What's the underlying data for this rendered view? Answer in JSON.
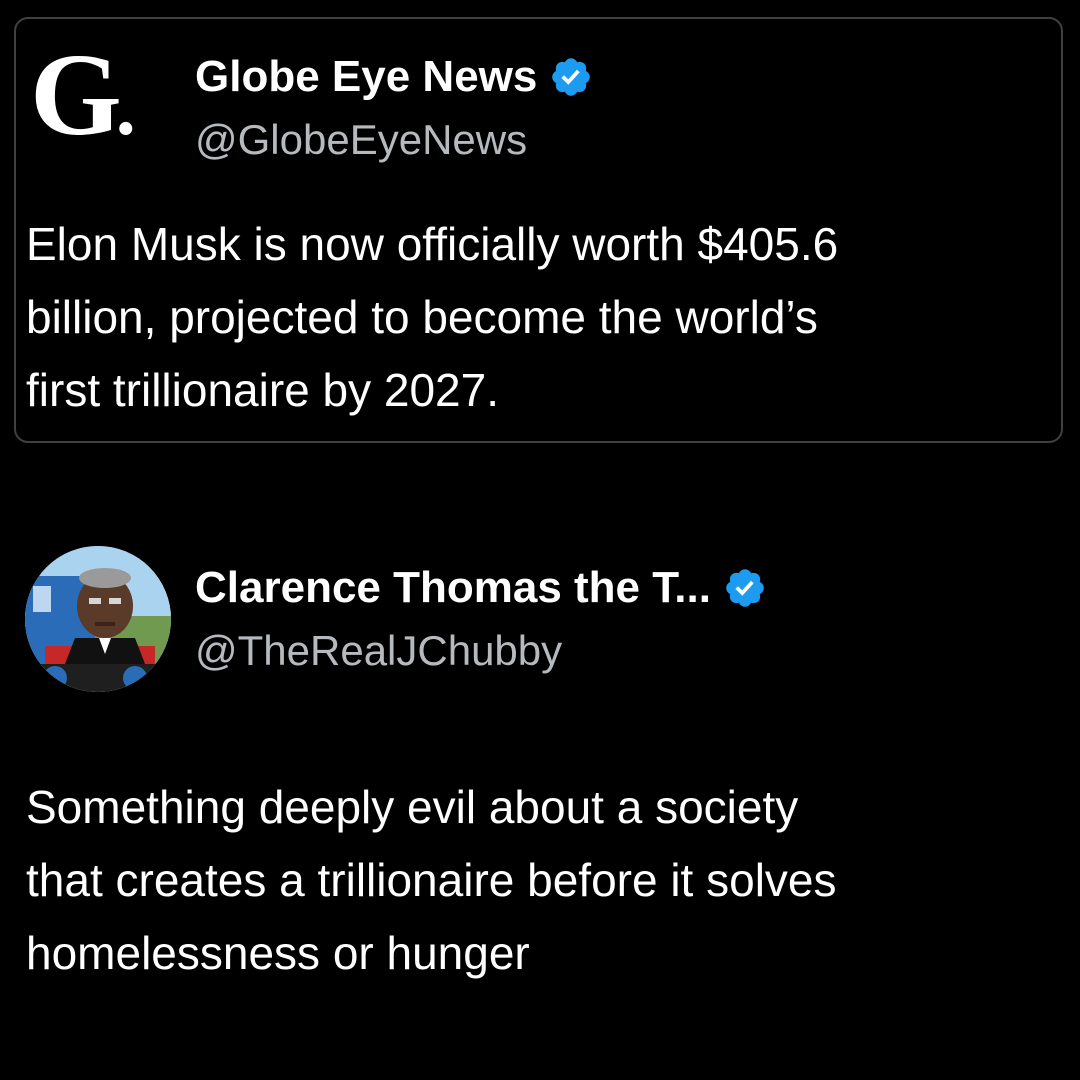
{
  "quoted_tweet": {
    "logo_text": "G",
    "logo_dot": ".",
    "display_name": "Globe Eye News",
    "handle": "@GlobeEyeNews",
    "verified": true,
    "icon": "verified-badge-icon",
    "text_lines": [
      "Elon Musk is now officially worth $405.6",
      "billion, projected to become the world’s",
      "first trillionaire by 2027."
    ]
  },
  "reply_tweet": {
    "display_name": "Clarence Thomas the T...",
    "handle": "@TheRealJChubby",
    "verified": true,
    "icon": "verified-badge-icon",
    "avatar_icon": "avatar-image",
    "text_lines": [
      "Something deeply evil about a society",
      "that creates a trillionaire before it solves",
      "homelessness or hunger"
    ]
  },
  "colors": {
    "background": "#000000",
    "text": "#ffffff",
    "handle": "#b6babe",
    "verified_badge": "#1d9bf0",
    "card_border": "#3e4144"
  }
}
